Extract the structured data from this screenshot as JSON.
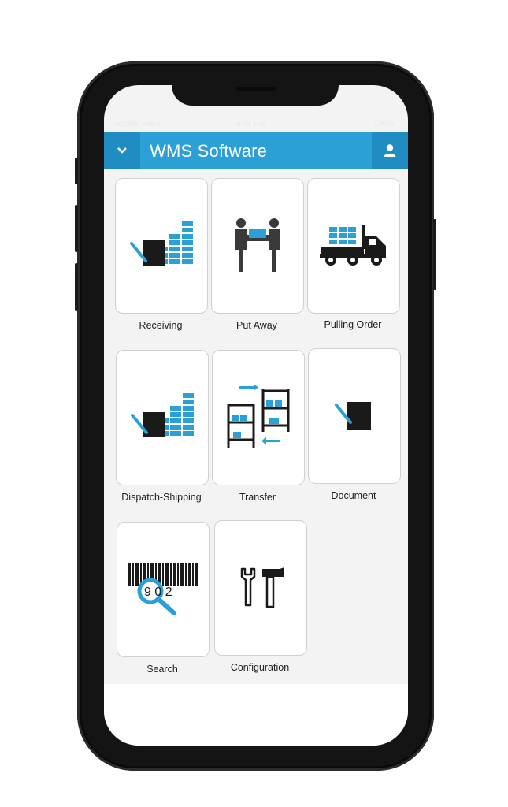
{
  "header": {
    "title": "WMS Software",
    "menu_icon": "chevron-down-icon",
    "user_icon": "user-icon"
  },
  "status_bar": {
    "carrier": "Mobile Telco",
    "time": "9:41 PM",
    "battery": "100%"
  },
  "tiles": [
    {
      "label": "Receiving",
      "icon": "receiving-icon"
    },
    {
      "label": "Put Away",
      "icon": "handover-icon"
    },
    {
      "label": "Pulling Order",
      "icon": "truck-icon"
    },
    {
      "label": "Dispatch-Shipping",
      "icon": "dispatch-icon"
    },
    {
      "label": "Transfer",
      "icon": "transfer-shelves-icon"
    },
    {
      "label": "Document",
      "icon": "document-icon"
    },
    {
      "label": "Search",
      "icon": "barcode-search-icon"
    },
    {
      "label": "Configuration",
      "icon": "tools-icon"
    }
  ],
  "barcode_digits": "9 0 2",
  "colors": {
    "accent": "#2aa0d6",
    "accent_dark": "#1f8dc1",
    "icon_dark": "#1a1a1a"
  }
}
